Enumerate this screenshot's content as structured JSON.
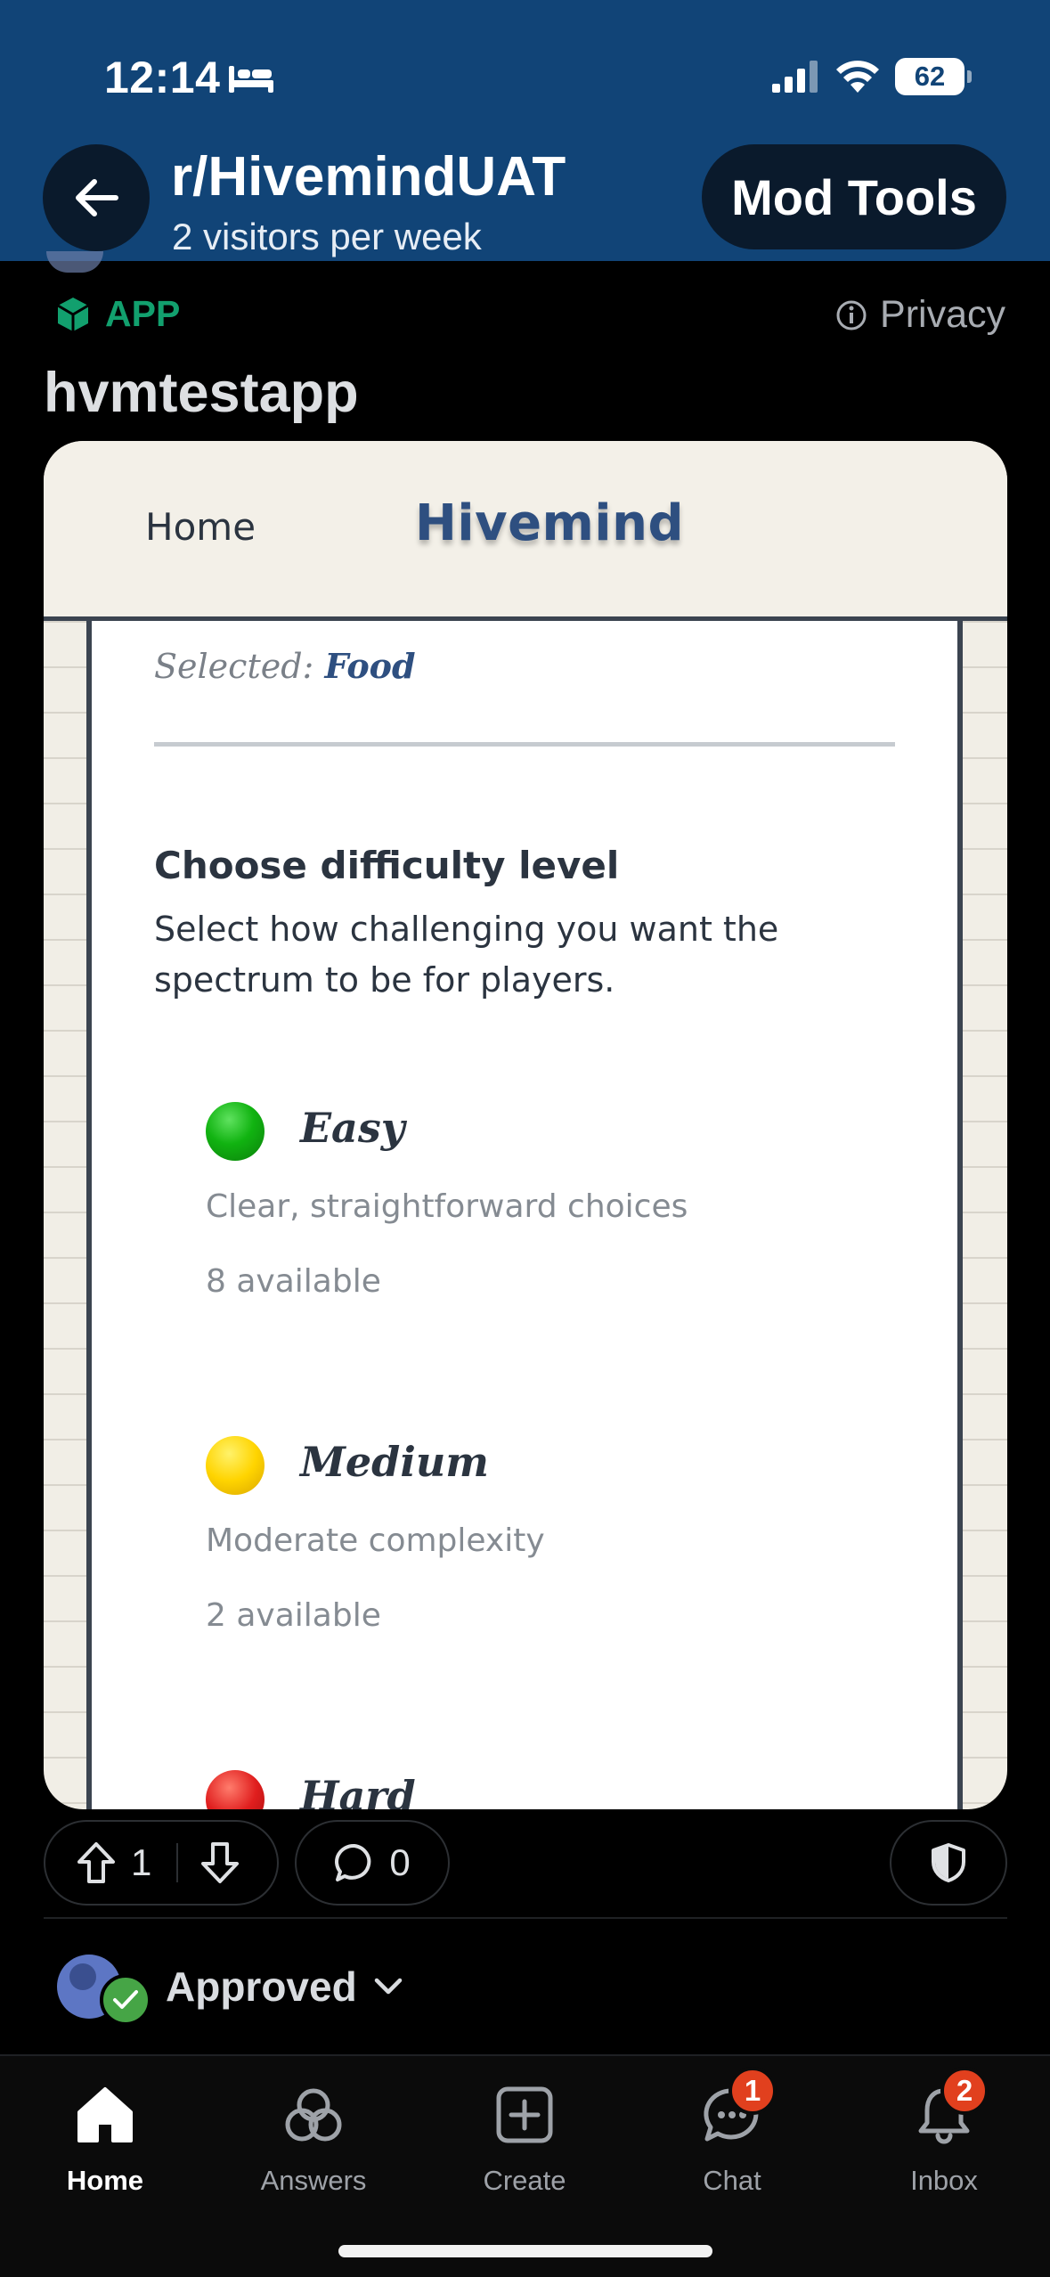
{
  "status_bar": {
    "time": "12:14",
    "battery": "62"
  },
  "header": {
    "subreddit": "r/HivemindUAT",
    "visitors": "2 visitors per week",
    "mod_tools_label": "Mod Tools"
  },
  "post": {
    "app_tag": "APP",
    "privacy_label": "Privacy",
    "title": "hvmtestapp"
  },
  "app": {
    "nav_home": "Home",
    "nav_brand": "Hivemind",
    "selected_prefix": "Selected:",
    "selected_value": "Food",
    "heading": "Choose difficulty level",
    "description": "Select how challenging you want the spectrum to be for players.",
    "difficulties": [
      {
        "name": "Easy",
        "subtitle": "Clear, straightforward choices",
        "count": "8 available",
        "color": "#11b311"
      },
      {
        "name": "Medium",
        "subtitle": "Moderate complexity",
        "count": "2 available",
        "color": "#ffd400"
      },
      {
        "name": "Hard",
        "color": "#e01e1e"
      }
    ]
  },
  "actions": {
    "votes": "1",
    "comments": "0",
    "approved_label": "Approved"
  },
  "tabbar": {
    "tabs": [
      {
        "label": "Home",
        "icon": "home-icon"
      },
      {
        "label": "Answers",
        "icon": "answers-icon"
      },
      {
        "label": "Create",
        "icon": "plus-square-icon"
      },
      {
        "label": "Chat",
        "icon": "chat-icon",
        "badge": "1"
      },
      {
        "label": "Inbox",
        "icon": "bell-icon",
        "badge": "2"
      }
    ]
  }
}
